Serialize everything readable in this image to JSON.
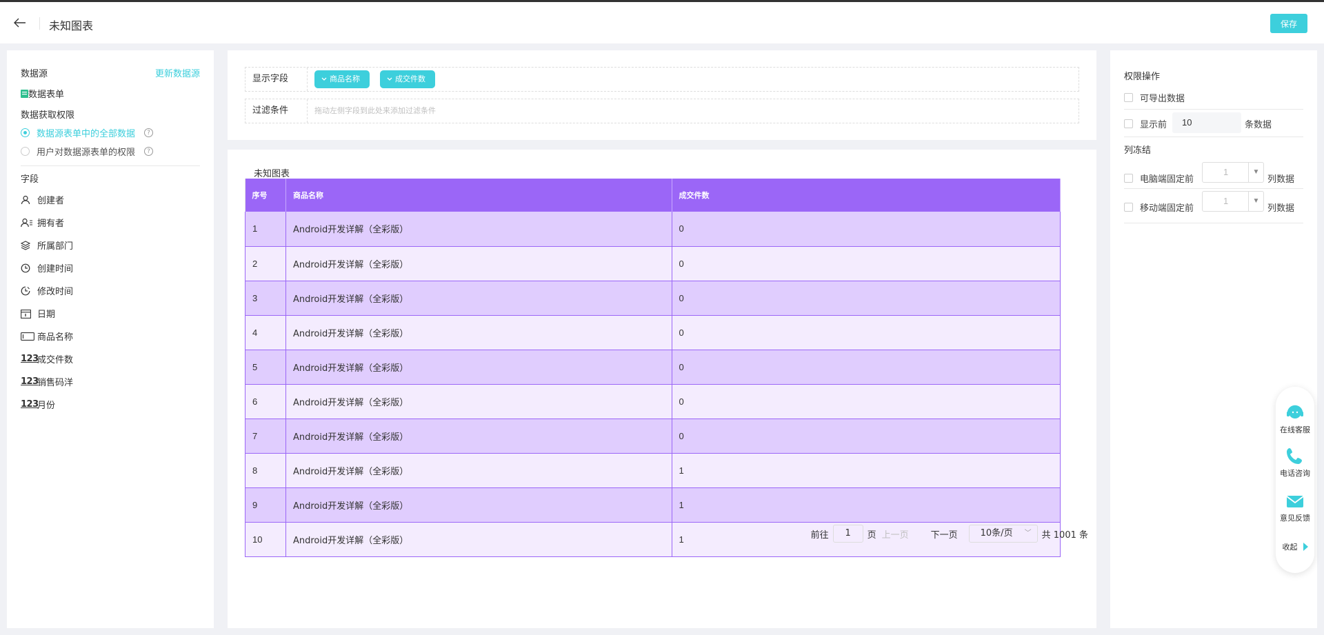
{
  "header": {
    "title": "未知图表",
    "save_label": "保存"
  },
  "left": {
    "datasource_label": "数据源",
    "refresh_label": "更新数据源",
    "datasource_name": "数据表单",
    "permission_label": "数据获取权限",
    "permission_options": [
      {
        "label": "数据源表单中的全部数据",
        "selected": true
      },
      {
        "label": "用户对数据源表单的权限",
        "selected": false
      }
    ],
    "fields_label": "字段",
    "fields": [
      {
        "label": "创建者",
        "icon": "user-icon"
      },
      {
        "label": "拥有者",
        "icon": "owner-icon"
      },
      {
        "label": "所属部门",
        "icon": "layers-icon"
      },
      {
        "label": "创建时间",
        "icon": "clock-icon"
      },
      {
        "label": "修改时间",
        "icon": "clock-edit-icon"
      },
      {
        "label": "日期",
        "icon": "calendar-icon"
      },
      {
        "label": "商品名称",
        "icon": "text-field-icon"
      },
      {
        "label": "成交件数",
        "icon": "number-icon"
      },
      {
        "label": "销售码洋",
        "icon": "number-icon"
      },
      {
        "label": "月份",
        "icon": "number-icon"
      }
    ],
    "number_icon_text": "123"
  },
  "config": {
    "display_label": "显示字段",
    "display_tags": [
      "商品名称",
      "成交件数"
    ],
    "filter_label": "过滤条件",
    "filter_placeholder": "拖动左侧字段到此处来添加过滤条件"
  },
  "table": {
    "title": "未知图表",
    "columns": [
      "序号",
      "商品名称",
      "成交件数"
    ],
    "rows": [
      [
        "1",
        "Android开发详解（全彩版）",
        "0"
      ],
      [
        "2",
        "Android开发详解（全彩版）",
        "0"
      ],
      [
        "3",
        "Android开发详解（全彩版）",
        "0"
      ],
      [
        "4",
        "Android开发详解（全彩版）",
        "0"
      ],
      [
        "5",
        "Android开发详解（全彩版）",
        "0"
      ],
      [
        "6",
        "Android开发详解（全彩版）",
        "0"
      ],
      [
        "7",
        "Android开发详解（全彩版）",
        "0"
      ],
      [
        "8",
        "Android开发详解（全彩版）",
        "1"
      ],
      [
        "9",
        "Android开发详解（全彩版）",
        "1"
      ],
      [
        "10",
        "Android开发详解（全彩版）",
        "1"
      ]
    ],
    "header_color": "#9b66f7",
    "row_colors": [
      "#e0cdfe",
      "#f4ecfe"
    ]
  },
  "pager": {
    "goto_label": "前往",
    "page_value": "1",
    "page_unit": "页",
    "prev_label": "上一页",
    "next_label": "下一页",
    "page_size": "10条/页",
    "total": "共 1001 条"
  },
  "right": {
    "permission_title": "权限操作",
    "export_label": "可导出数据",
    "show_first_label": "显示前",
    "show_first_value": "10",
    "show_first_suffix": "条数据",
    "freeze_title": "列冻结",
    "pc_label": "电脑端固定前",
    "pc_value": "1",
    "mobile_label": "移动端固定前",
    "mobile_value": "1",
    "col_suffix": "列数据"
  },
  "float": {
    "service_label": "在线客服",
    "phone_label": "电话咨询",
    "feedback_label": "意见反馈",
    "collapse_label": "收起"
  },
  "accent_color": "#3dcfdc"
}
